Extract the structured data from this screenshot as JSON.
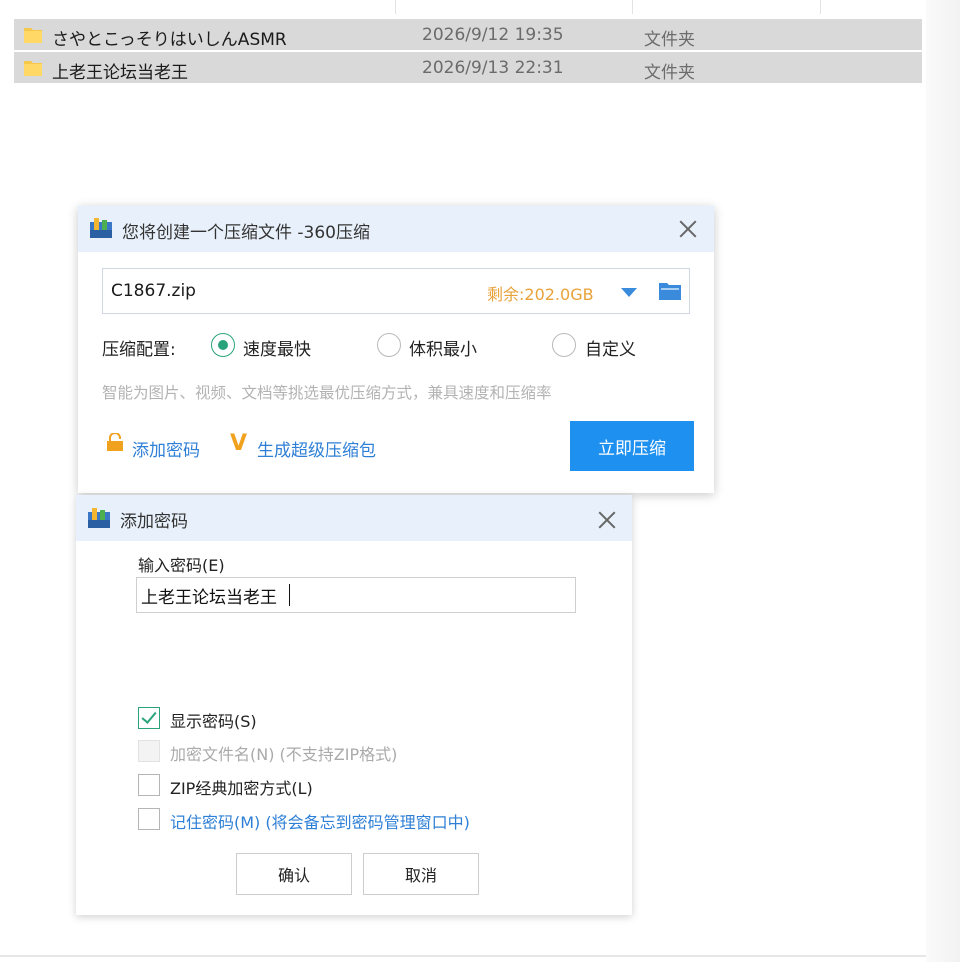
{
  "files": [
    {
      "name": "さやとこっそりはいしんASMR",
      "date": "2026/9/12 19:35",
      "type": "文件夹"
    },
    {
      "name": "上老王论坛当老王",
      "date": "2026/9/13 22:31",
      "type": "文件夹"
    }
  ],
  "compress_dialog": {
    "title": "您将创建一个压缩文件 -360压缩",
    "filename": "C1867.zip",
    "space_left": "剩余:202.0GB",
    "config_label": "压缩配置:",
    "options": [
      "速度最快",
      "体积最小",
      "自定义"
    ],
    "selected_option": "速度最快",
    "hint": "智能为图片、视频、文档等挑选最优压缩方式，兼具速度和压缩率",
    "add_password": "添加密码",
    "super_pack": "生成超级压缩包",
    "compress_button": "立即压缩"
  },
  "password_dialog": {
    "title": "添加密码",
    "input_label": "输入密码(E)",
    "password_value": "上老王论坛当老王",
    "checkboxes": [
      {
        "label": "显示密码(S)",
        "checked": true,
        "enabled": true
      },
      {
        "label": "加密文件名(N) (不支持ZIP格式)",
        "checked": false,
        "enabled": false
      },
      {
        "label": "ZIP经典加密方式(L)",
        "checked": false,
        "enabled": true
      },
      {
        "label": "记住密码(M) (将会备忘到密码管理窗口中)",
        "checked": false,
        "enabled": true
      }
    ],
    "ok_button": "确认",
    "cancel_button": "取消"
  },
  "colors": {
    "accent": "#1e90f0",
    "radio_check_green": "#29a37c",
    "space_orange": "#e8a23a",
    "title_bar": "#e8f1fb",
    "selected_row": "#d9d9d9"
  }
}
